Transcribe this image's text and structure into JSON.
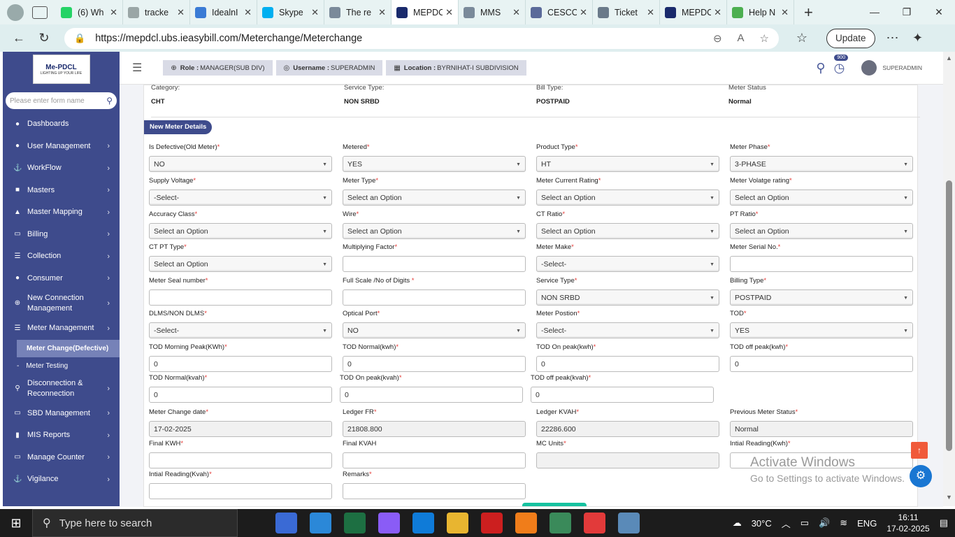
{
  "browser": {
    "tabs": [
      {
        "label": "(6) Wh",
        "color": "#25d366"
      },
      {
        "label": "tracke",
        "color": "#9aa6a6"
      },
      {
        "label": "IdealnI",
        "color": "#3a7bd5"
      },
      {
        "label": "Skype",
        "color": "#00aff0"
      },
      {
        "label": "The re",
        "color": "#7a8a9a"
      },
      {
        "label": "MEPDC",
        "color": "#1a2a6c",
        "active": true
      },
      {
        "label": "MMS",
        "color": "#7a8a9a"
      },
      {
        "label": "CESCO",
        "color": "#5a6a9a"
      },
      {
        "label": "Ticket",
        "color": "#6a7a8a"
      },
      {
        "label": "MEPDC",
        "color": "#1a2a6c"
      },
      {
        "label": "Help N",
        "color": "#4caf50"
      }
    ],
    "url": "https://mepdcl.ubs.ieasybill.com/Meterchange/Meterchange",
    "update_label": "Update"
  },
  "sidebar": {
    "logo_title": "Me-PDCL",
    "logo_tagline": "LIGHTING UP YOUR LIFE",
    "search_placeholder": "Please enter form name",
    "items": [
      {
        "label": "Dashboards",
        "icon": "●"
      },
      {
        "label": "User Management",
        "icon": "●",
        "chev": "›"
      },
      {
        "label": "WorkFlow",
        "icon": "⚓",
        "chev": "›"
      },
      {
        "label": "Masters",
        "icon": "■",
        "chev": "›"
      },
      {
        "label": "Master Mapping",
        "icon": "▲",
        "chev": "›"
      },
      {
        "label": "Billing",
        "icon": "▭",
        "chev": "›"
      },
      {
        "label": "Collection",
        "icon": "☰",
        "chev": "›"
      },
      {
        "label": "Consumer",
        "icon": "●",
        "chev": "›"
      },
      {
        "label": "New Connection Management",
        "icon": "⊕",
        "chev": "›"
      },
      {
        "label": "Meter Management",
        "icon": "☰",
        "chev": "›"
      }
    ],
    "sub_items": [
      {
        "label": "Meter Change(Defective)"
      },
      {
        "label": "Meter Testing"
      }
    ],
    "items_after": [
      {
        "label": "Disconnection & Reconnection",
        "icon": "⚲",
        "chev": "›"
      },
      {
        "label": "SBD Management",
        "icon": "▭",
        "chev": "›"
      },
      {
        "label": "MIS Reports",
        "icon": "▮",
        "chev": "›"
      },
      {
        "label": "Manage Counter",
        "icon": "▭",
        "chev": "›"
      },
      {
        "label": "Vigilance",
        "icon": "⚓",
        "chev": "›"
      }
    ]
  },
  "header": {
    "role_label": "Role :",
    "role_value": "MANAGER(SUB DIV)",
    "username_label": "Username :",
    "username_value": "SUPERADMIN",
    "location_label": "Location :",
    "location_value": "BYRNIHAT-I SUBDIVISION",
    "notification_count": "900",
    "user_name": "SUPERADMIN"
  },
  "top_info": [
    {
      "label": "Category:",
      "value": "CHT"
    },
    {
      "label": "Service Type:",
      "value": "NON SRBD"
    },
    {
      "label": "Bill Type:",
      "value": "POSTPAID"
    },
    {
      "label": "Meter Status",
      "value": "Normal"
    }
  ],
  "section_title": "New Meter Details",
  "fields": [
    {
      "label": "Is Defective(Old Meter)",
      "req": "*",
      "type": "select",
      "value": "NO"
    },
    {
      "label": "Metered",
      "req": "*",
      "type": "select",
      "value": "YES"
    },
    {
      "label": "Product Type",
      "req": "*",
      "type": "select",
      "value": "HT"
    },
    {
      "label": "Meter Phase",
      "req": "*",
      "type": "select",
      "value": "3-PHASE"
    },
    {
      "label": "Supply Voltage",
      "req": "*",
      "type": "select",
      "value": "-Select-"
    },
    {
      "label": "Meter Type",
      "req": "*",
      "type": "select",
      "value": "Select an Option"
    },
    {
      "label": "Meter Current Rating",
      "req": "*",
      "type": "select",
      "value": "Select an Option"
    },
    {
      "label": "Meter Volatge rating",
      "req": "*",
      "type": "select",
      "value": "Select an Option"
    },
    {
      "label": "Accuracy Class",
      "req": "*",
      "type": "select",
      "value": "Select an Option"
    },
    {
      "label": "Wire",
      "req": "*",
      "type": "select",
      "value": "Select an Option"
    },
    {
      "label": "CT Ratio",
      "req": "*",
      "type": "select",
      "value": "Select an Option"
    },
    {
      "label": "PT Ratio",
      "req": "*",
      "type": "select",
      "value": "Select an Option"
    },
    {
      "label": "CT PT Type",
      "req": "*",
      "type": "select",
      "value": "Select an Option"
    },
    {
      "label": "Multiplying Factor",
      "req": "*",
      "type": "input",
      "value": ""
    },
    {
      "label": "Meter Make",
      "req": "*",
      "type": "select",
      "value": "-Select-"
    },
    {
      "label": "Meter Serial No.",
      "req": "*",
      "type": "input",
      "value": ""
    },
    {
      "label": "Meter Seal number",
      "req": "*",
      "type": "input",
      "value": ""
    },
    {
      "label": "Full Scale /No of Digits ",
      "req": "*",
      "type": "input",
      "value": ""
    },
    {
      "label": "Service Type",
      "req": "*",
      "type": "select",
      "value": "NON SRBD"
    },
    {
      "label": "Billing Type",
      "req": "*",
      "type": "select",
      "value": "POSTPAID"
    },
    {
      "label": "DLMS/NON DLMS",
      "req": "*",
      "type": "select",
      "value": "-Select-"
    },
    {
      "label": "Optical Port",
      "req": "*",
      "type": "select",
      "value": "NO"
    },
    {
      "label": "Meter Postion",
      "req": "*",
      "type": "select",
      "value": "-Select-"
    },
    {
      "label": "TOD",
      "req": "*",
      "type": "select",
      "value": "YES"
    },
    {
      "label": "TOD Morning Peak(KWh)",
      "req": "*",
      "type": "input",
      "value": "0"
    },
    {
      "label": "TOD Normal(kwh)",
      "req": "*",
      "type": "input",
      "value": "0"
    },
    {
      "label": "TOD On peak(kwh)",
      "req": "*",
      "type": "input",
      "value": "0"
    },
    {
      "label": "TOD off peak(kwh)",
      "req": "*",
      "type": "input",
      "value": "0"
    },
    {
      "label": "TOD Normal(kvah)",
      "req": "*",
      "type": "input",
      "value": "0"
    },
    {
      "label": "TOD On peak(kvah)",
      "req": "*",
      "type": "input",
      "value": "0"
    },
    {
      "label": "TOD off peak(kvah)",
      "req": "*",
      "type": "input",
      "value": "0"
    },
    {
      "label": "Meter Change date",
      "req": "*",
      "type": "readonly",
      "value": "17-02-2025"
    },
    {
      "label": "Ledger FR",
      "req": "*",
      "type": "readonly",
      "value": "21808.800"
    },
    {
      "label": "Ledger KVAH",
      "req": "*",
      "type": "readonly",
      "value": "22286.600"
    },
    {
      "label": "Previous Meter Status",
      "req": "*",
      "type": "readonly",
      "value": "Normal"
    },
    {
      "label": "Final KWH",
      "req": "*",
      "type": "input",
      "value": ""
    },
    {
      "label": "Final KVAH",
      "req": "",
      "type": "input",
      "value": ""
    },
    {
      "label": "MC Units",
      "req": "*",
      "type": "readonly",
      "value": ""
    },
    {
      "label": "Intial Reading(Kwh)",
      "req": "*",
      "type": "input",
      "value": ""
    },
    {
      "label": "Intial Reading(Kvah)",
      "req": "*",
      "type": "input",
      "value": ""
    },
    {
      "label": "Remarks",
      "req": "*",
      "type": "input",
      "value": ""
    }
  ],
  "watermark": {
    "line1": "Activate Windows",
    "line2": "Go to Settings to activate Windows."
  },
  "taskbar": {
    "search_placeholder": "Type here to search",
    "weather": "30°C",
    "language": "ENG",
    "time": "16:11",
    "date": "17-02-2025"
  }
}
